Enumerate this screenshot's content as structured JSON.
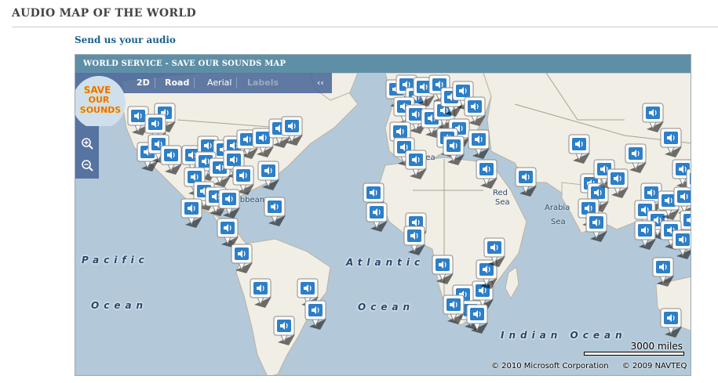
{
  "page": {
    "title": "AUDIO MAP OF THE WORLD",
    "send_link": "Send us your audio"
  },
  "map": {
    "header": "WORLD SERVICE - SAVE OUR SOUNDS MAP",
    "style_options": {
      "two_d": "2D",
      "road": "Road",
      "aerial": "Aerial",
      "labels": "Labels",
      "collapse": "‹‹"
    },
    "ocean_labels": {
      "pacific_1": "Pacific",
      "pacific_2": "Ocean",
      "atlantic_1": "Atlantic",
      "atlantic_2": "Ocean",
      "indian": "Indian Ocean"
    },
    "place_labels": {
      "sea": "Sea",
      "caribbean": "ibbean",
      "red_sea_1": "Red",
      "red_sea_2": "Sea",
      "arabian_1": "Arabia",
      "arabian_2": "Sea"
    },
    "scale": "3000 miles",
    "copyright_ms": "© 2010 Microsoft Corporation",
    "copyright_navteq": "© 2009 NAVTEQ",
    "logo": {
      "line1": "SAVE",
      "line2": "OUR",
      "line3": "SOUNDS"
    },
    "colors": {
      "header": "#5f8fa6",
      "ocean": "#b3c9d9",
      "land": "#f1eee5",
      "pin_icon": "#2c7fc8"
    },
    "icons": [
      "compass-icon",
      "zoom-in-icon",
      "zoom-out-icon",
      "audio-pin-icon"
    ]
  }
}
